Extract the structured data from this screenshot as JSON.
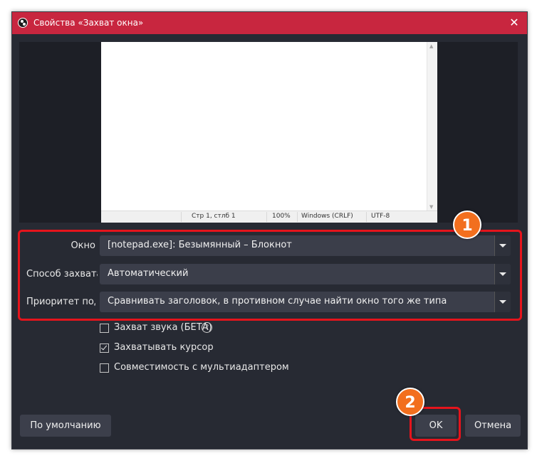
{
  "window": {
    "title": "Свойства «Захват окна»",
    "close_icon": "close-icon",
    "accent_color": "#c8263f"
  },
  "preview": {
    "notepad_status": {
      "position": "Стр 1, стлб 1",
      "zoom": "100%",
      "line_endings": "Windows (CRLF)",
      "encoding": "UTF-8"
    }
  },
  "form": {
    "fields": [
      {
        "label": "Окно",
        "value": "[notepad.exe]: Безымянный – Блокнот"
      },
      {
        "label": "Способ захвата",
        "value": "Автоматический"
      },
      {
        "label": "Приоритет подбора окна",
        "value": "Сравнивать заголовок, в противном случае найти окно того же типа"
      }
    ],
    "checkboxes": [
      {
        "label": "Захват звука (БЕТА)",
        "checked": false
      },
      {
        "label": "Захватывать курсор",
        "checked": true
      },
      {
        "label": "Совместимость с мультиадаптером",
        "checked": false
      }
    ],
    "help_icon": "question-circle-icon"
  },
  "buttons": {
    "defaults": "По умолчанию",
    "ok": "OK",
    "cancel": "Отмена"
  },
  "annotations": {
    "badge1": "1",
    "badge2": "2",
    "highlight_color": "#e5141c",
    "badge_color": "#f26f1e"
  }
}
